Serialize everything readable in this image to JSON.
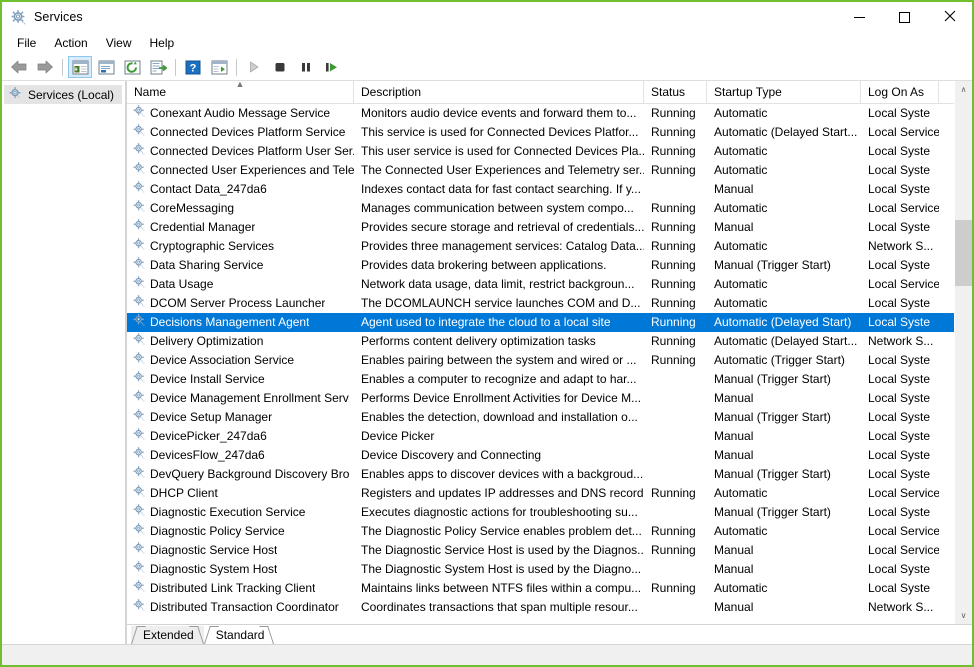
{
  "window": {
    "title": "Services",
    "icon": "services-gear-icon",
    "border_color": "#6fbf2f",
    "controls": {
      "minimize": "minimize-button",
      "maximize": "maximize-button",
      "close": "close-button"
    }
  },
  "menubar": {
    "items": [
      {
        "label": "File"
      },
      {
        "label": "Action"
      },
      {
        "label": "View"
      },
      {
        "label": "Help"
      }
    ]
  },
  "toolbar": {
    "buttons": [
      {
        "name": "back-arrow-icon",
        "active": false
      },
      {
        "name": "forward-arrow-icon",
        "active": false
      },
      {
        "name": "separator"
      },
      {
        "name": "show-hide-console-tree-icon",
        "active": true
      },
      {
        "name": "properties-icon",
        "active": false
      },
      {
        "name": "refresh-icon",
        "active": false
      },
      {
        "name": "export-list-icon",
        "active": false
      },
      {
        "name": "separator"
      },
      {
        "name": "help-icon",
        "active": false
      },
      {
        "name": "show-action-pane-icon",
        "active": false
      },
      {
        "name": "separator"
      },
      {
        "name": "start-service-icon",
        "active": false
      },
      {
        "name": "stop-service-icon",
        "active": false
      },
      {
        "name": "pause-service-icon",
        "active": false
      },
      {
        "name": "restart-service-icon",
        "active": false
      }
    ]
  },
  "tree": {
    "nodes": [
      {
        "label": "Services (Local)",
        "selected": true
      }
    ]
  },
  "list": {
    "columns": [
      {
        "key": "name",
        "label": "Name",
        "sorted": "asc"
      },
      {
        "key": "desc",
        "label": "Description",
        "sorted": ""
      },
      {
        "key": "status",
        "label": "Status",
        "sorted": ""
      },
      {
        "key": "start",
        "label": "Startup Type",
        "sorted": ""
      },
      {
        "key": "logon",
        "label": "Log On As",
        "sorted": ""
      }
    ],
    "selection_color": "#0078d7",
    "rows": [
      {
        "name": "Conexant Audio Message Service",
        "desc": "Monitors audio device events and forward them to...",
        "status": "Running",
        "start": "Automatic",
        "logon": "Local Syste",
        "selected": false
      },
      {
        "name": "Connected Devices Platform Service",
        "desc": "This service is used for Connected Devices Platfor...",
        "status": "Running",
        "start": "Automatic (Delayed Start...",
        "logon": "Local Service",
        "selected": false
      },
      {
        "name": "Connected Devices Platform User Ser...",
        "desc": "This user service is used for Connected Devices Pla...",
        "status": "Running",
        "start": "Automatic",
        "logon": "Local Syste",
        "selected": false
      },
      {
        "name": "Connected User Experiences and Tele...",
        "desc": "The Connected User Experiences and Telemetry ser...",
        "status": "Running",
        "start": "Automatic",
        "logon": "Local Syste",
        "selected": false
      },
      {
        "name": "Contact Data_247da6",
        "desc": "Indexes contact data for fast contact searching. If y...",
        "status": "",
        "start": "Manual",
        "logon": "Local Syste",
        "selected": false
      },
      {
        "name": "CoreMessaging",
        "desc": "Manages communication between system compo...",
        "status": "Running",
        "start": "Automatic",
        "logon": "Local Service",
        "selected": false
      },
      {
        "name": "Credential Manager",
        "desc": "Provides secure storage and retrieval of credentials...",
        "status": "Running",
        "start": "Manual",
        "logon": "Local Syste",
        "selected": false
      },
      {
        "name": "Cryptographic Services",
        "desc": "Provides three management services: Catalog Data...",
        "status": "Running",
        "start": "Automatic",
        "logon": "Network S...",
        "selected": false
      },
      {
        "name": "Data Sharing Service",
        "desc": "Provides data brokering between applications.",
        "status": "Running",
        "start": "Manual (Trigger Start)",
        "logon": "Local Syste",
        "selected": false
      },
      {
        "name": "Data Usage",
        "desc": "Network data usage, data limit, restrict backgroun...",
        "status": "Running",
        "start": "Automatic",
        "logon": "Local Service",
        "selected": false
      },
      {
        "name": "DCOM Server Process Launcher",
        "desc": "The DCOMLAUNCH service launches COM and D...",
        "status": "Running",
        "start": "Automatic",
        "logon": "Local Syste",
        "selected": false
      },
      {
        "name": "Decisions Management Agent",
        "desc": "Agent used to integrate the cloud to a local site",
        "status": "Running",
        "start": "Automatic (Delayed Start)",
        "logon": "Local Syste",
        "selected": true
      },
      {
        "name": "Delivery Optimization",
        "desc": "Performs content delivery optimization tasks",
        "status": "Running",
        "start": "Automatic (Delayed Start...",
        "logon": "Network S...",
        "selected": false
      },
      {
        "name": "Device Association Service",
        "desc": "Enables pairing between the system and wired or ...",
        "status": "Running",
        "start": "Automatic (Trigger Start)",
        "logon": "Local Syste",
        "selected": false
      },
      {
        "name": "Device Install Service",
        "desc": "Enables a computer to recognize and adapt to har...",
        "status": "",
        "start": "Manual (Trigger Start)",
        "logon": "Local Syste",
        "selected": false
      },
      {
        "name": "Device Management Enrollment Serv",
        "desc": "Performs Device Enrollment Activities for Device M...",
        "status": "",
        "start": "Manual",
        "logon": "Local Syste",
        "selected": false
      },
      {
        "name": "Device Setup Manager",
        "desc": "Enables the detection, download and installation o...",
        "status": "",
        "start": "Manual (Trigger Start)",
        "logon": "Local Syste",
        "selected": false
      },
      {
        "name": "DevicePicker_247da6",
        "desc": "Device Picker",
        "status": "",
        "start": "Manual",
        "logon": "Local Syste",
        "selected": false
      },
      {
        "name": "DevicesFlow_247da6",
        "desc": "Device Discovery and Connecting",
        "status": "",
        "start": "Manual",
        "logon": "Local Syste",
        "selected": false
      },
      {
        "name": "DevQuery Background Discovery Bro",
        "desc": "Enables apps to discover devices with a backgroud...",
        "status": "",
        "start": "Manual (Trigger Start)",
        "logon": "Local Syste",
        "selected": false
      },
      {
        "name": "DHCP Client",
        "desc": "Registers and updates IP addresses and DNS record...",
        "status": "Running",
        "start": "Automatic",
        "logon": "Local Service",
        "selected": false
      },
      {
        "name": "Diagnostic Execution Service",
        "desc": "Executes diagnostic actions for troubleshooting su...",
        "status": "",
        "start": "Manual (Trigger Start)",
        "logon": "Local Syste",
        "selected": false
      },
      {
        "name": "Diagnostic Policy Service",
        "desc": "The Diagnostic Policy Service enables problem det...",
        "status": "Running",
        "start": "Automatic",
        "logon": "Local Service",
        "selected": false
      },
      {
        "name": "Diagnostic Service Host",
        "desc": "The Diagnostic Service Host is used by the Diagnos...",
        "status": "Running",
        "start": "Manual",
        "logon": "Local Service",
        "selected": false
      },
      {
        "name": "Diagnostic System Host",
        "desc": "The Diagnostic System Host is used by the Diagno...",
        "status": "",
        "start": "Manual",
        "logon": "Local Syste",
        "selected": false
      },
      {
        "name": "Distributed Link Tracking Client",
        "desc": "Maintains links between NTFS files within a compu...",
        "status": "Running",
        "start": "Automatic",
        "logon": "Local Syste",
        "selected": false
      },
      {
        "name": "Distributed Transaction Coordinator",
        "desc": "Coordinates transactions that span multiple resour...",
        "status": "",
        "start": "Manual",
        "logon": "Network S...",
        "selected": false
      }
    ]
  },
  "scrollbar": {
    "up_arrow": "∧",
    "down_arrow": "∨",
    "thumb_top_pct": 24,
    "thumb_height_pct": 13
  },
  "tabs": [
    {
      "label": "Extended",
      "selected": true
    },
    {
      "label": "Standard",
      "selected": false
    }
  ]
}
